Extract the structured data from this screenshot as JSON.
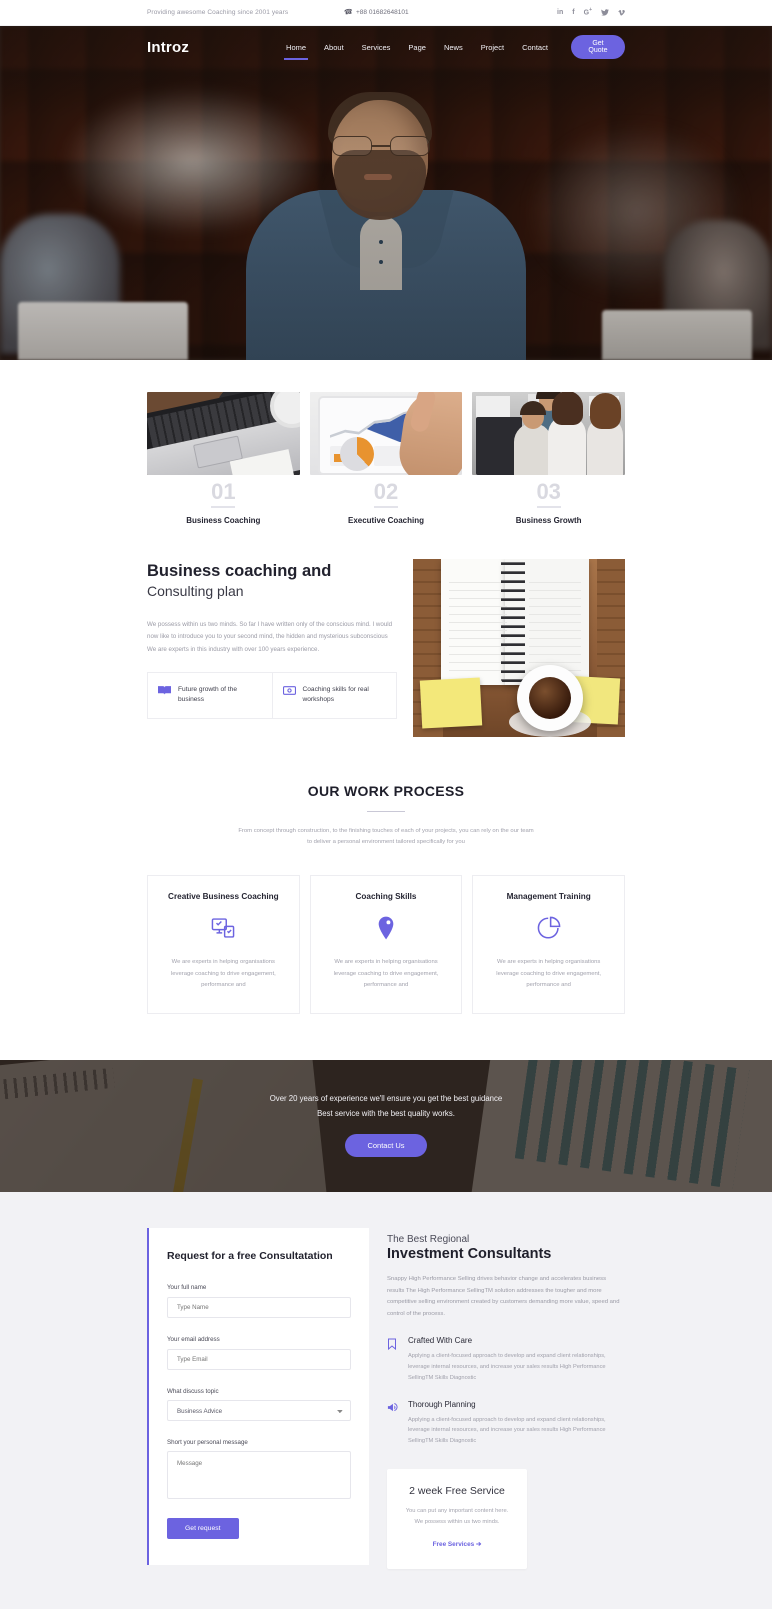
{
  "topbar": {
    "tagline": "Providing awesome Coaching since 2001 years",
    "phone": "+88 01682648101",
    "social": [
      {
        "name": "linkedin-icon",
        "label": "in"
      },
      {
        "name": "facebook-icon",
        "label": "f"
      },
      {
        "name": "google-plus-icon",
        "label": "G+"
      },
      {
        "name": "twitter-icon",
        "label": "t"
      },
      {
        "name": "vimeo-icon",
        "label": "v"
      }
    ]
  },
  "nav": {
    "logo_primary": "Intro",
    "logo_accent": "z",
    "links": [
      {
        "label": "Home",
        "active": true
      },
      {
        "label": "About",
        "active": false
      },
      {
        "label": "Services",
        "active": false
      },
      {
        "label": "Page",
        "active": false
      },
      {
        "label": "News",
        "active": false
      },
      {
        "label": "Project",
        "active": false
      },
      {
        "label": "Contact",
        "active": false
      }
    ],
    "quote_button": "Get Quote"
  },
  "features": [
    {
      "number": "01",
      "title": "Business Coaching",
      "image": "laptop-on-desk-photo"
    },
    {
      "number": "02",
      "title": "Executive Coaching",
      "image": "tablet-analytics-chart-photo"
    },
    {
      "number": "03",
      "title": "Business Growth",
      "image": "team-at-computer-photo"
    }
  ],
  "about": {
    "heading_bold": "Business coaching and",
    "heading_light": "Consulting plan",
    "paragraph": "We possess within us two minds. So far I have written only of the conscious mind. I would now like to introduce you to your second mind, the hidden and mysterious subconscious We are experts in this industry with over 100 years experience.",
    "cards": [
      {
        "icon": "open-book-icon",
        "text": "Future growth of the business"
      },
      {
        "icon": "presentation-board-icon",
        "text": "Coaching skills for real workshops"
      }
    ],
    "image": "spiral-notebook-with-coffee-photo"
  },
  "process": {
    "title": "OUR WORK PROCESS",
    "subtitle": "From concept through construction, to the finishing touches of each of your projects, you can rely on the our team to deliver a personal environment tailored specifically for you",
    "services": [
      {
        "title": "Creative Business Coaching",
        "icon": "devices-checklist-icon",
        "text": "We are experts in helping organisations leverage coaching to drive engagement, performance and"
      },
      {
        "title": "Coaching Skills",
        "icon": "location-pin-icon",
        "text": "We are experts in helping organisations leverage coaching to drive engagement, performance and"
      },
      {
        "title": "Management Training",
        "icon": "pie-chart-icon",
        "text": "We are experts in helping organisations leverage coaching to drive engagement, performance and"
      }
    ]
  },
  "cta": {
    "line1": "Over 20 years of experience we'll ensure you get the best guidance",
    "line2": "Best service with the best quality works.",
    "button": "Contact Us"
  },
  "form": {
    "title": "Request for a free Consultatation",
    "name_label": "Your full name",
    "name_placeholder": "Type Name",
    "email_label": "Your email address",
    "email_placeholder": "Type Email",
    "topic_label": "What discuss topic",
    "topic_value": "Business Advice",
    "topic_options": [
      "Business Advice"
    ],
    "message_label": "Short your personal message",
    "message_placeholder": "Message",
    "submit_label": "Get request"
  },
  "consultants": {
    "eyebrow": "The Best Regional",
    "title": "Investment Consultants",
    "paragraph": "Snappy High Performance Selling drives behavior change and accelerates business results The High Performance SellingTM solution addresses the tougher and more competitive selling environment created by customers demanding more value, speed and control of the process.",
    "items": [
      {
        "icon": "bookmark-icon",
        "title": "Crafted With Care",
        "text": "Applying a client-focused approach to develop and expand client relationships, leverage internal resources, and increase your sales results High Performance SellingTM Skills Diagnostic"
      },
      {
        "icon": "megaphone-icon",
        "title": "Thorough Planning",
        "text": "Applying a client-focused approach to develop and expand client relationships, leverage internal resources, and increase your sales results High Performance SellingTM Skills Diagnostic"
      }
    ],
    "promo": {
      "title": "2 week Free Service",
      "text": "You can put any important content here. We possess within us two minds.",
      "link": "Free Services ➔"
    }
  },
  "colors": {
    "accent": "#6c63e0",
    "heading": "#22222e",
    "muted": "#9b9ba6",
    "section_bg": "#f2f2f5"
  }
}
